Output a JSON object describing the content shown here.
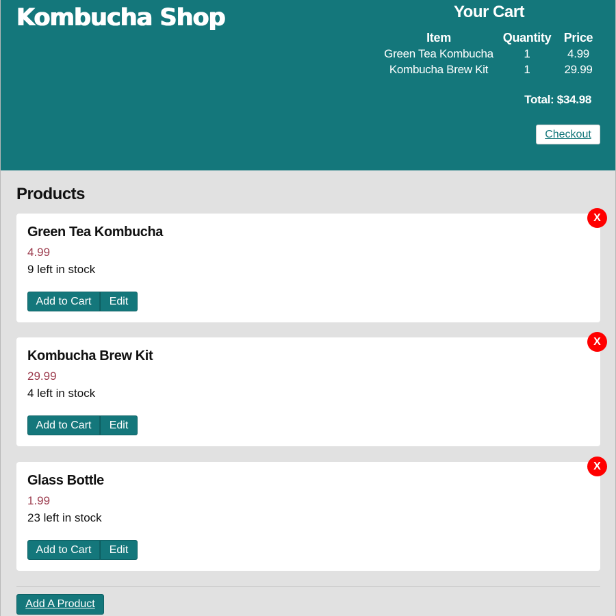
{
  "header": {
    "logo": "Kombucha Shop"
  },
  "cart": {
    "title": "Your Cart",
    "columns": {
      "item": "Item",
      "quantity": "Quantity",
      "price": "Price"
    },
    "rows": [
      {
        "item": "Green Tea Kombucha",
        "quantity": "1",
        "price": "4.99"
      },
      {
        "item": "Kombucha Brew Kit",
        "quantity": "1",
        "price": "29.99"
      }
    ],
    "total": "Total: $34.98",
    "checkout_label": "Checkout"
  },
  "products": {
    "title": "Products",
    "items": [
      {
        "name": "Green Tea Kombucha",
        "price": "4.99",
        "stock": "9 left in stock"
      },
      {
        "name": "Kombucha Brew Kit",
        "price": "29.99",
        "stock": "4 left in stock"
      },
      {
        "name": "Glass Bottle",
        "price": "1.99",
        "stock": "23 left in stock"
      }
    ],
    "add_to_cart_label": "Add to Cart",
    "edit_label": "Edit",
    "delete_label": "X",
    "add_product_label": "Add A Product"
  },
  "colors": {
    "brand": "#14777b",
    "price": "#9b3a4c",
    "delete": "#ff0000",
    "background": "#e1e1e1"
  }
}
